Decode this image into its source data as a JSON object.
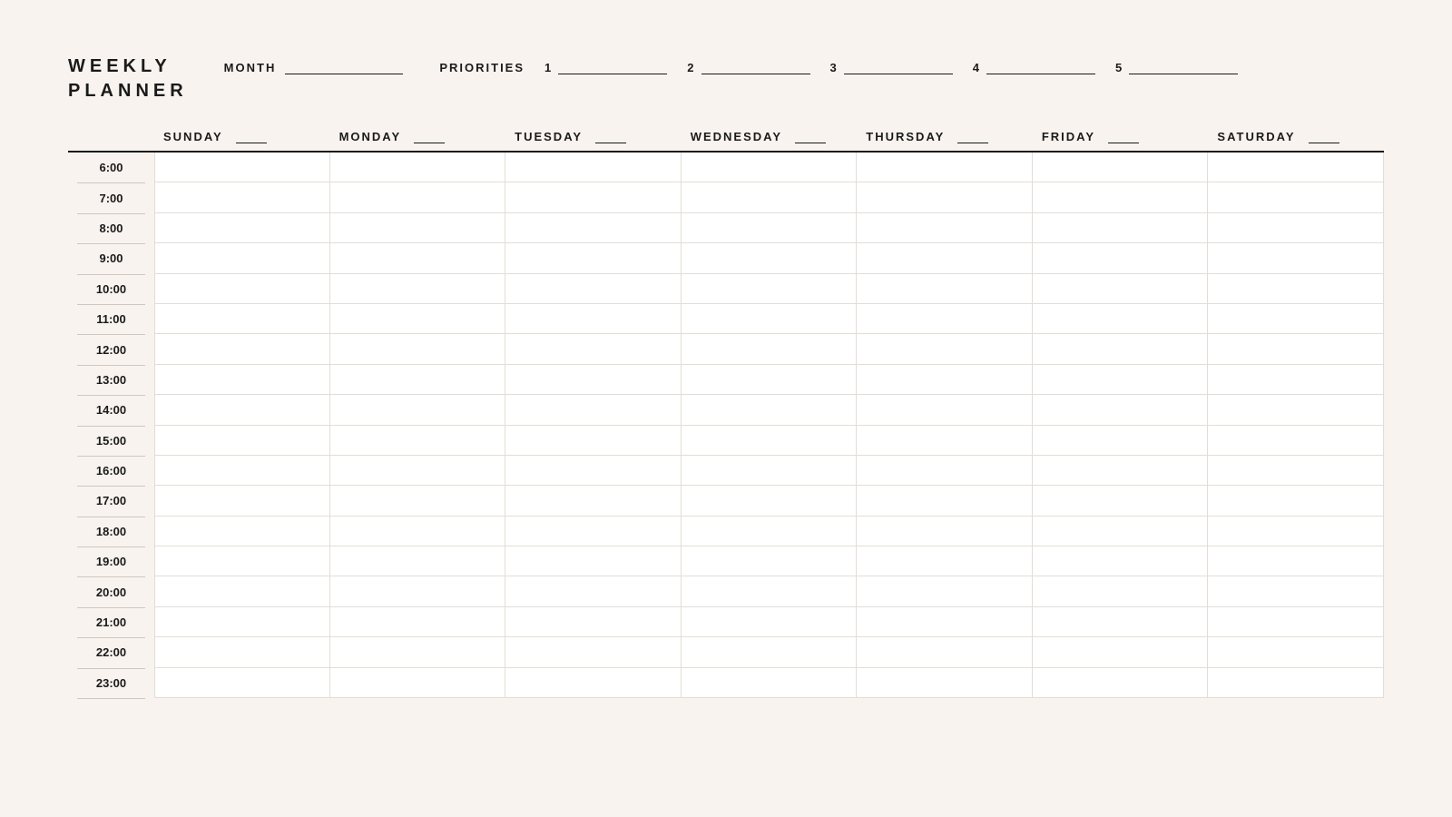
{
  "title_line1": "WEEKLY",
  "title_line2": "PLANNER",
  "month_label": "MONTH",
  "priorities_label": "PRIORITIES",
  "priorities": [
    "1",
    "2",
    "3",
    "4",
    "5"
  ],
  "days": [
    "SUNDAY",
    "MONDAY",
    "TUESDAY",
    "WEDNESDAY",
    "THURSDAY",
    "FRIDAY",
    "SATURDAY"
  ],
  "times": [
    "6:00",
    "7:00",
    "8:00",
    "9:00",
    "10:00",
    "11:00",
    "12:00",
    "13:00",
    "14:00",
    "15:00",
    "16:00",
    "17:00",
    "18:00",
    "19:00",
    "20:00",
    "21:00",
    "22:00",
    "23:00"
  ]
}
